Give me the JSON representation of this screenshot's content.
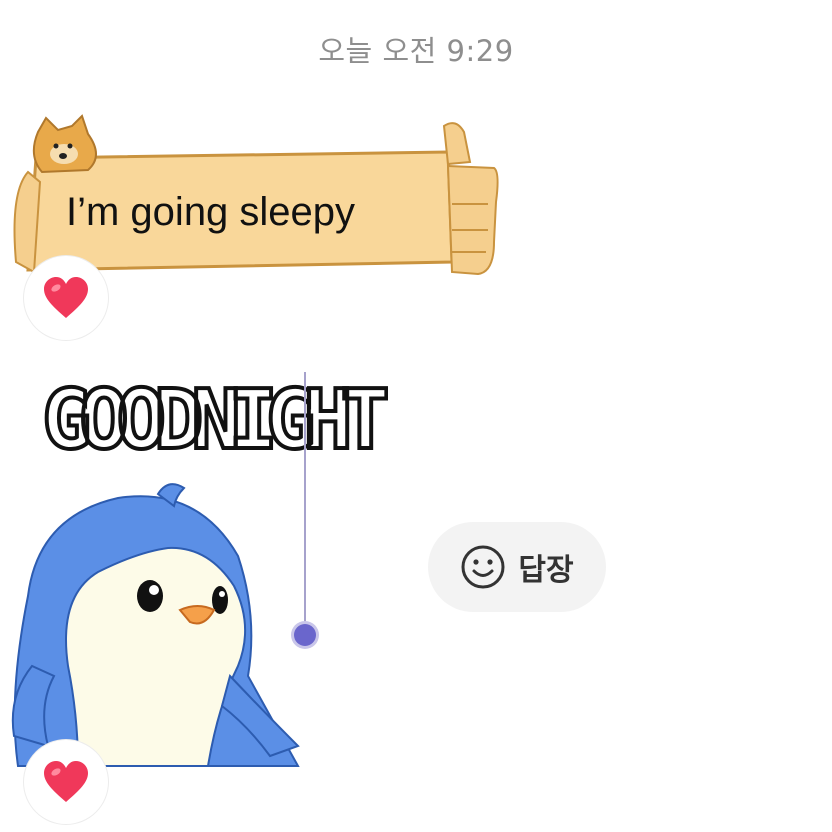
{
  "timestamp": "오늘 오전 9:29",
  "messages": [
    {
      "type": "sticker-text",
      "text": "I’m going sleepy",
      "sticker": "doge-holding-sign",
      "reaction": "heart-emoji"
    },
    {
      "type": "sticker",
      "caption": "GOODNIGHT",
      "sticker": "blue-penguin",
      "reaction": "heart-emoji"
    }
  ],
  "reply_button": {
    "label": "답장",
    "icon": "smile-icon"
  },
  "colors": {
    "sign_fill": "#f9d79a",
    "sign_stroke": "#c9933f",
    "heart": "#f0385a",
    "scrubber": "#6a66cc",
    "penguin_blue": "#5b8fe6",
    "timestamp_text": "#8e8e8e",
    "reply_bg": "#f3f3f3"
  }
}
